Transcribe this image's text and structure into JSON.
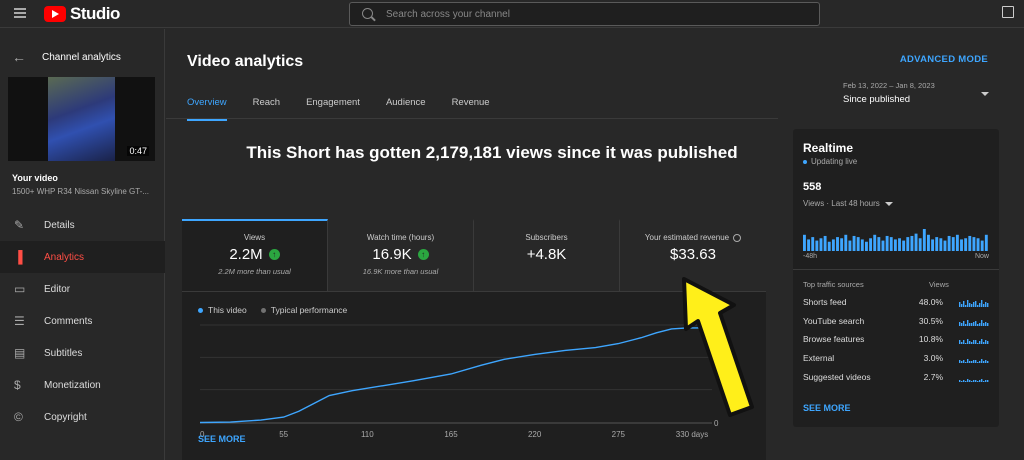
{
  "topbar": {
    "logo_text": "Studio",
    "search_placeholder": "Search across your channel"
  },
  "sidebar": {
    "back_label": "Channel analytics",
    "thumb_duration": "0:47",
    "your_video_label": "Your video",
    "video_title": "1500+ WHP R34 Nissan Skyline GT-...",
    "items": [
      {
        "label": "Details",
        "icon": "pencil-icon",
        "glyph": "✎"
      },
      {
        "label": "Analytics",
        "icon": "analytics-icon",
        "glyph": "▐"
      },
      {
        "label": "Editor",
        "icon": "editor-icon",
        "glyph": "▭"
      },
      {
        "label": "Comments",
        "icon": "comments-icon",
        "glyph": "☰"
      },
      {
        "label": "Subtitles",
        "icon": "subtitles-icon",
        "glyph": "▤"
      },
      {
        "label": "Monetization",
        "icon": "dollar-icon",
        "glyph": "$"
      },
      {
        "label": "Copyright",
        "icon": "copyright-icon",
        "glyph": "©"
      }
    ],
    "active_index": 1
  },
  "main": {
    "title": "Video analytics",
    "advanced_mode": "ADVANCED MODE",
    "tabs": [
      "Overview",
      "Reach",
      "Engagement",
      "Audience",
      "Revenue"
    ],
    "date_range": "Feb 13, 2022 – Jan 8, 2023",
    "date_value": "Since published",
    "headline": "This Short has gotten 2,179,181 views since it was published",
    "metrics": [
      {
        "label": "Views",
        "value": "2.2M",
        "up": true,
        "sub": "2.2M more than usual"
      },
      {
        "label": "Watch time (hours)",
        "value": "16.9K",
        "up": true,
        "sub": "16.9K more than usual"
      },
      {
        "label": "Subscribers",
        "value": "+4.8K",
        "up": false,
        "sub": ""
      },
      {
        "label": "Your estimated revenue",
        "value": "$33.63",
        "up": false,
        "sub": ""
      }
    ],
    "legend": {
      "this_video": "This video",
      "typical": "Typical performance"
    },
    "see_more": "SEE MORE"
  },
  "chart_data": {
    "type": "line",
    "x_ticks": [
      "0",
      "55",
      "110",
      "165",
      "220",
      "275",
      "330 days"
    ],
    "y_ticks_right": [
      "0"
    ],
    "series": [
      {
        "name": "This video",
        "x": [
          0,
          20,
          40,
          55,
          65,
          75,
          85,
          100,
          120,
          140,
          165,
          185,
          200,
          220,
          240,
          260,
          275,
          290,
          300,
          310,
          320,
          330
        ],
        "y": [
          0.5,
          1,
          3,
          6,
          12,
          20,
          28,
          33,
          38,
          43,
          50,
          59,
          65,
          70,
          74,
          77,
          81,
          87,
          92,
          96,
          97,
          97
        ]
      }
    ],
    "xlim": [
      0,
      330
    ],
    "ylim": [
      0,
      100
    ],
    "colors": {
      "this_video": "#3ea6ff",
      "typical": "#717171"
    }
  },
  "realtime": {
    "title": "Realtime",
    "live_label": "Updating live",
    "count": "558",
    "sub_label": "Views · Last 48 hours",
    "axis_left": "-48h",
    "axis_right": "Now",
    "bars": [
      14,
      10,
      12,
      9,
      11,
      13,
      8,
      10,
      12,
      11,
      14,
      9,
      13,
      12,
      10,
      8,
      11,
      14,
      12,
      9,
      13,
      12,
      10,
      11,
      9,
      12,
      13,
      15,
      11,
      19,
      14,
      10,
      12,
      11,
      9,
      13,
      12,
      14,
      10,
      11,
      13,
      12,
      11,
      9,
      14
    ],
    "sources_header": "Top traffic sources",
    "views_header": "Views",
    "sources": [
      {
        "label": "Shorts feed",
        "pct": "48.0%"
      },
      {
        "label": "YouTube search",
        "pct": "30.5%"
      },
      {
        "label": "Browse features",
        "pct": "10.8%"
      },
      {
        "label": "External",
        "pct": "3.0%"
      },
      {
        "label": "Suggested videos",
        "pct": "2.7%"
      }
    ],
    "see_more": "SEE MORE"
  }
}
